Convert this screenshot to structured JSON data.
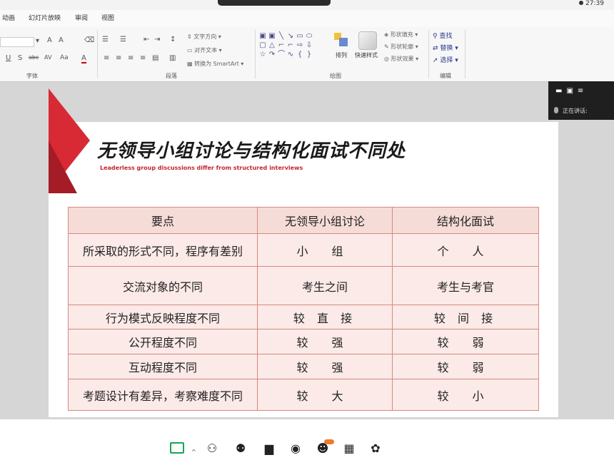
{
  "status": {
    "time": "27:39"
  },
  "ribbon": {
    "tabs": [
      "动画",
      "幻灯片放映",
      "审阅",
      "视图"
    ],
    "groups": [
      "字体",
      "段落",
      "绘图",
      "编辑"
    ],
    "paragraph": {
      "text_direction": "文字方向",
      "align_text": "对齐文本",
      "to_smartart": "转换为 SmartArt"
    },
    "drawing": {
      "arrange": "排列",
      "quick_styles": "快速样式",
      "shape_fill": "形状填充",
      "shape_outline": "形状轮廓",
      "shape_effects": "形状效果"
    },
    "editing": {
      "find": "查找",
      "replace": "替换",
      "select": "选择"
    }
  },
  "meeting_panel": {
    "speaking_label": "正在讲话:"
  },
  "slide": {
    "title": "无领导小组讨论与结构化面试不同处",
    "subtitle": "Leaderless group discussions differ from structured interviews",
    "table": {
      "headers": [
        "要点",
        "无领导小组讨论",
        "结构化面试"
      ],
      "rows": [
        [
          "所采取的形式不同，程序有差别",
          "小 组",
          "个 人"
        ],
        [
          "交流对象的不同",
          "考生之间",
          "考生与考官"
        ],
        [
          "行为模式反映程度不同",
          "较 直 接",
          "较 间 接"
        ],
        [
          "公开程度不同",
          "较 强",
          "较 弱"
        ],
        [
          "互动程度不同",
          "较 强",
          "较 弱"
        ],
        [
          "考题设计有差异，考察难度不同",
          "较 大",
          "较 小"
        ]
      ]
    }
  },
  "colors": {
    "accent_red": "#d72a35",
    "dark_red": "#a31c26",
    "table_border": "#d48a82",
    "table_fill": "#fbeae7",
    "share_green": "#19a35a"
  }
}
